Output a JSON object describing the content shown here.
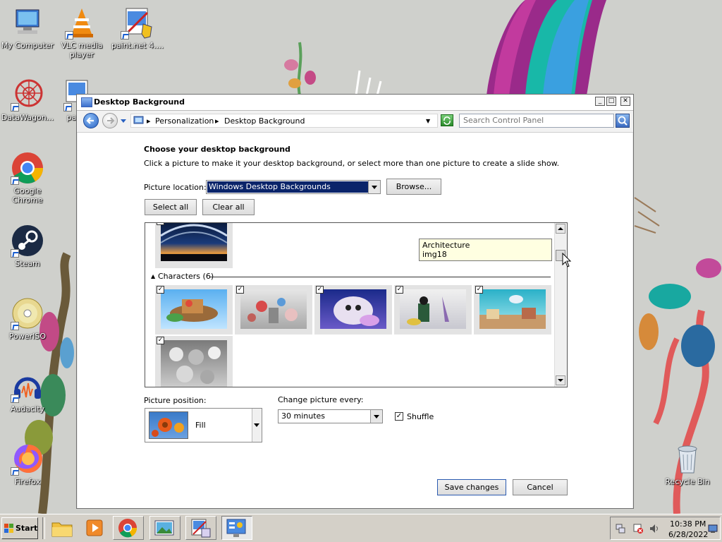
{
  "desktop": {
    "icons": [
      {
        "name": "my-computer",
        "label": "My Computer",
        "icon": "computer-icon"
      },
      {
        "name": "vlc",
        "label": "VLC media player",
        "icon": "vlc-cone-icon"
      },
      {
        "name": "paintnet",
        "label": "paint.net 4....",
        "icon": "paintnet-icon"
      },
      {
        "name": "datawagon",
        "label": "DataWagon...",
        "icon": "datawagon-icon"
      },
      {
        "name": "pai",
        "label": "pai",
        "icon": "app-icon"
      },
      {
        "name": "chrome",
        "label": "Google Chrome",
        "icon": "chrome-icon"
      },
      {
        "name": "steam",
        "label": "Steam",
        "icon": "steam-icon"
      },
      {
        "name": "poweriso",
        "label": "PowerISO",
        "icon": "disc-icon"
      },
      {
        "name": "audacity",
        "label": "Audacity",
        "icon": "headphones-icon"
      },
      {
        "name": "firefox",
        "label": "Firefox",
        "icon": "firefox-icon"
      },
      {
        "name": "recycle-bin",
        "label": "Recycle Bin",
        "icon": "recycle-bin-icon"
      }
    ]
  },
  "window": {
    "title": "Desktop Background",
    "breadcrumb": [
      "Personalization",
      "Desktop Background"
    ],
    "search_placeholder": "Search Control Panel",
    "heading": "Choose your desktop background",
    "description": "Click a picture to make it your desktop background, or select more than one picture to create a slide show.",
    "picture_location_label": "Picture location:",
    "picture_location_value": "Windows Desktop Backgrounds",
    "browse_label": "Browse...",
    "select_all_label": "Select all",
    "clear_all_label": "Clear all",
    "tooltip_line1": "Architecture",
    "tooltip_line2": "img18",
    "group_label": "Characters (6)",
    "picture_position_label": "Picture position:",
    "picture_position_value": "Fill",
    "change_every_label": "Change picture every:",
    "change_every_value": "30 minutes",
    "shuffle_label": "Shuffle",
    "shuffle_checked": true,
    "save_label": "Save changes",
    "cancel_label": "Cancel"
  },
  "taskbar": {
    "start_label": "Start",
    "time": "10:38 PM",
    "date": "6/28/2022"
  },
  "colors": {
    "selection": "#0a246a",
    "tooltip_bg": "#ffffe1",
    "thumb_bg": "#e3e3e3"
  }
}
